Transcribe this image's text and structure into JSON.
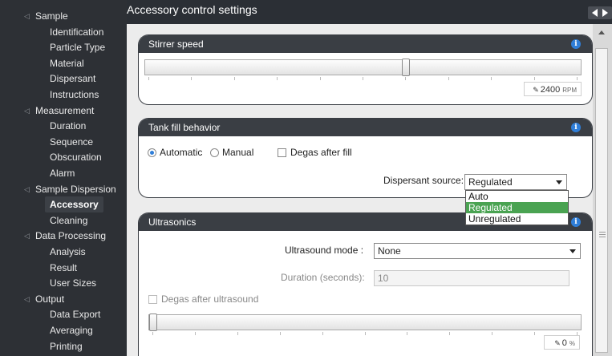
{
  "sidebar": {
    "items": [
      {
        "label": "Sample",
        "level": "top"
      },
      {
        "label": "Identification",
        "level": "sub"
      },
      {
        "label": "Particle Type",
        "level": "sub"
      },
      {
        "label": "Material",
        "level": "sub"
      },
      {
        "label": "Dispersant",
        "level": "sub"
      },
      {
        "label": "Instructions",
        "level": "sub"
      },
      {
        "label": "Measurement",
        "level": "top"
      },
      {
        "label": "Duration",
        "level": "sub"
      },
      {
        "label": "Sequence",
        "level": "sub"
      },
      {
        "label": "Obscuration",
        "level": "sub"
      },
      {
        "label": "Alarm",
        "level": "sub"
      },
      {
        "label": "Sample Dispersion",
        "level": "top"
      },
      {
        "label": "Accessory",
        "level": "sub",
        "selected": true
      },
      {
        "label": "Cleaning",
        "level": "sub"
      },
      {
        "label": "Data Processing",
        "level": "top"
      },
      {
        "label": "Analysis",
        "level": "sub"
      },
      {
        "label": "Result",
        "level": "sub"
      },
      {
        "label": "User Sizes",
        "level": "sub"
      },
      {
        "label": "Output",
        "level": "top"
      },
      {
        "label": "Data Export",
        "level": "sub"
      },
      {
        "label": "Averaging",
        "level": "sub"
      },
      {
        "label": "Printing",
        "level": "sub"
      }
    ]
  },
  "header": {
    "title": "Accessory control settings"
  },
  "stirrer": {
    "title": "Stirrer speed",
    "value": "2400",
    "unit": "RPM",
    "fraction": 0.6
  },
  "tank": {
    "title": "Tank fill behavior",
    "automatic_label": "Automatic",
    "manual_label": "Manual",
    "degas_label": "Degas after fill",
    "source_label": "Dispersant source:",
    "source_value": "Regulated",
    "source_options": [
      "Auto",
      "Regulated",
      "Unregulated"
    ]
  },
  "ultrasonics": {
    "title": "Ultrasonics",
    "mode_label": "Ultrasound mode :",
    "mode_value": "None",
    "duration_label": "Duration (seconds):",
    "duration_value": "10",
    "degas_label": "Degas after ultrasound",
    "value": "0",
    "unit": "%",
    "fraction": 0
  },
  "colors": {
    "accent": "#2f7ed8",
    "selected_option": "#4aa352",
    "panel_header": "#3a3e44",
    "sidebar": "#2d3035"
  }
}
